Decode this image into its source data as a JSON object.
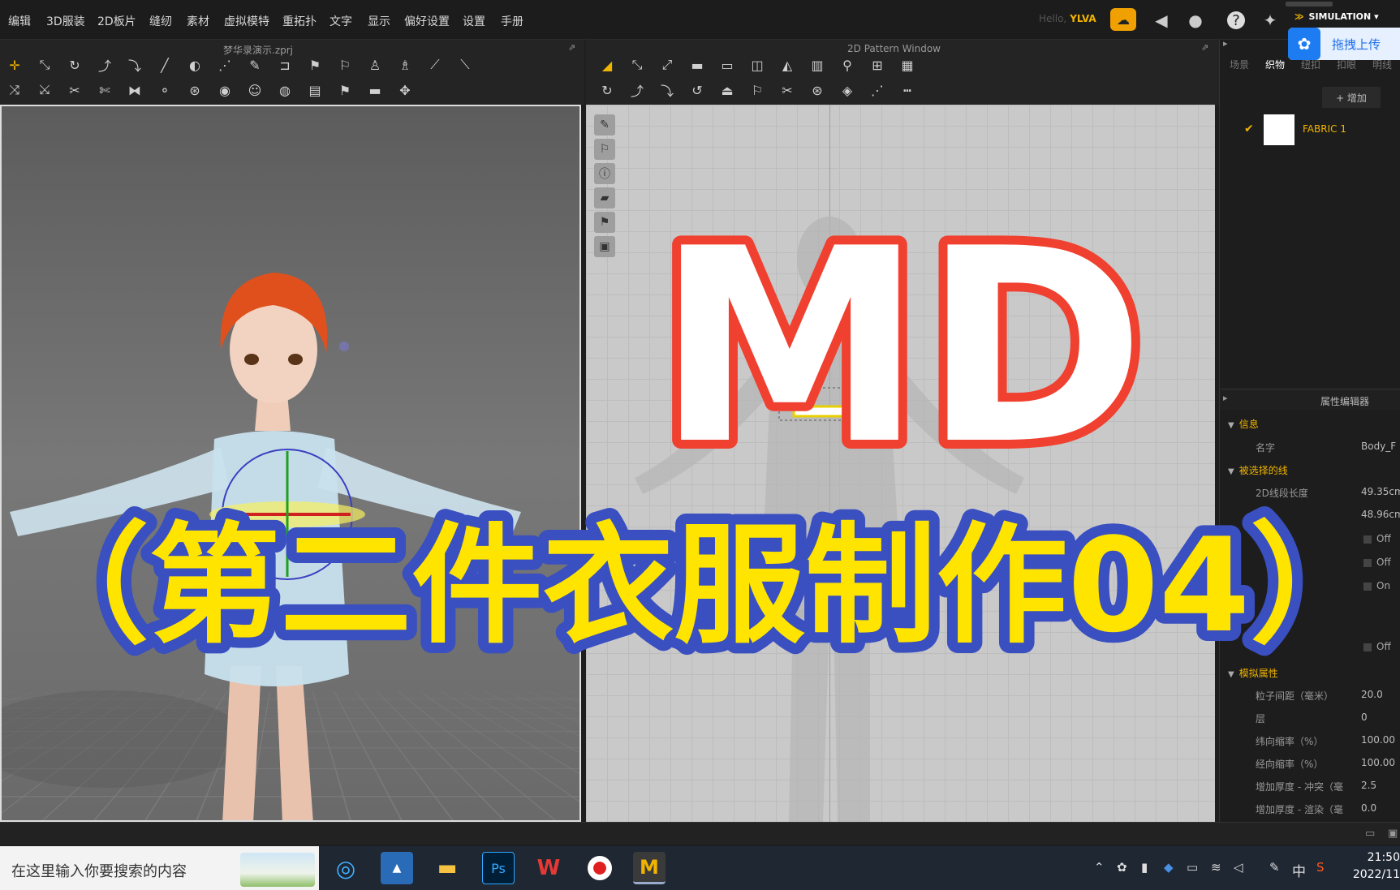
{
  "menu": [
    "编辑",
    "3D服装",
    "2D板片",
    "缝纫",
    "素材",
    "虚拟模特",
    "重拓扑",
    "文字",
    "显示",
    "偏好设置",
    "设置",
    "手册"
  ],
  "header": {
    "greeting": "Hello,",
    "user": "YLVA",
    "simulation_label": "SIMULATION",
    "upload_label": "拖拽上传"
  },
  "window_3d": {
    "title": "梦华录演示.zprj"
  },
  "window_2d": {
    "title": "2D Pattern Window"
  },
  "right_panel": {
    "tabs": [
      "场景",
      "织物",
      "纽扣",
      "扣眼",
      "明线"
    ],
    "active_tab": 1,
    "add_label": "+ 增加",
    "fabric_name": "FABRIC 1",
    "property_editor": "属性编辑器",
    "info_section": "信息",
    "name_key": "名字",
    "name_value": "Body_F",
    "selected_section": "被选择的线",
    "len2d_key": "2D线段长度",
    "len2d_value": "49.35cm",
    "len3d_value": "48.96cm",
    "toggles": [
      "Off",
      "Off",
      "On",
      "Off"
    ],
    "sim_section": "模拟属性",
    "sim_rows": [
      {
        "k": "粒子间距（毫米）",
        "v": "20.0"
      },
      {
        "k": "层",
        "v": "0"
      },
      {
        "k": "纬向缩率（%）",
        "v": "100.00"
      },
      {
        "k": "经向缩率（%）",
        "v": "100.00"
      },
      {
        "k": "增加厚度 - 冲突（毫",
        "v": "2.5"
      },
      {
        "k": "增加厚度 - 渲染（毫",
        "v": "0.0"
      }
    ]
  },
  "overlay": {
    "title": "MD",
    "subtitle": "（第二件衣服制作04）"
  },
  "taskbar": {
    "search_placeholder": "在这里输入你要搜索的内容",
    "time": "21:50",
    "date": "2022/11",
    "ime": "中"
  },
  "colors": {
    "accent": "#f0b400",
    "md_outline": "#f04030",
    "subtitle_fill": "#ffe400",
    "subtitle_outline": "#3a4fc0"
  }
}
